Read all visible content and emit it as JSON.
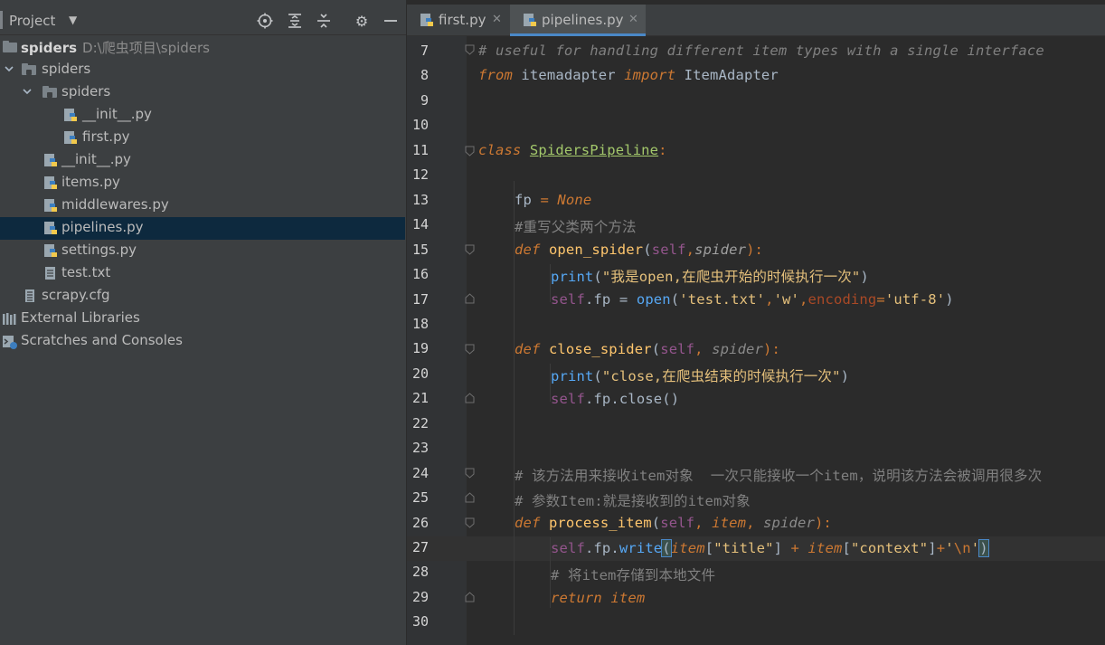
{
  "project_panel": {
    "title": "Project",
    "toolbar_icons": [
      "locate-icon",
      "expand-all-icon",
      "collapse-all-icon",
      "gear-icon",
      "minimize-icon"
    ],
    "tree": [
      {
        "label": "spiders",
        "path": "D:\\爬虫项目\\spiders",
        "type": "root-folder",
        "depth": 0,
        "expanded": true,
        "bold": true
      },
      {
        "label": "spiders",
        "type": "package",
        "depth": 1,
        "expanded": true
      },
      {
        "label": "spiders",
        "type": "package",
        "depth": 2,
        "expanded": true
      },
      {
        "label": "__init__.py",
        "type": "python",
        "depth": 3
      },
      {
        "label": "first.py",
        "type": "python",
        "depth": 3
      },
      {
        "label": "__init__.py",
        "type": "python",
        "depth": 2
      },
      {
        "label": "items.py",
        "type": "python",
        "depth": 2
      },
      {
        "label": "middlewares.py",
        "type": "python",
        "depth": 2
      },
      {
        "label": "pipelines.py",
        "type": "python",
        "depth": 2,
        "selected": true
      },
      {
        "label": "settings.py",
        "type": "python",
        "depth": 2
      },
      {
        "label": "test.txt",
        "type": "text",
        "depth": 2
      },
      {
        "label": "scrapy.cfg",
        "type": "config",
        "depth": 1
      },
      {
        "label": "External Libraries",
        "type": "libraries",
        "depth": 0
      },
      {
        "label": "Scratches and Consoles",
        "type": "scratches",
        "depth": 0
      }
    ]
  },
  "editor": {
    "tabs": [
      {
        "label": "first.py",
        "active": false
      },
      {
        "label": "pipelines.py",
        "active": true
      }
    ],
    "current_line": 27,
    "lines": [
      {
        "n": "7"
      },
      {
        "n": "8"
      },
      {
        "n": "9"
      },
      {
        "n": "10"
      },
      {
        "n": "11"
      },
      {
        "n": "12"
      },
      {
        "n": "13"
      },
      {
        "n": "14"
      },
      {
        "n": "15"
      },
      {
        "n": "16"
      },
      {
        "n": "17"
      },
      {
        "n": "18"
      },
      {
        "n": "19"
      },
      {
        "n": "20"
      },
      {
        "n": "21"
      },
      {
        "n": "22"
      },
      {
        "n": "23"
      },
      {
        "n": "24"
      },
      {
        "n": "25"
      },
      {
        "n": "26"
      },
      {
        "n": "27"
      },
      {
        "n": "28"
      },
      {
        "n": "29"
      },
      {
        "n": "30"
      }
    ],
    "code": {
      "l7_comment": "# useful for handling different item types with a single interface",
      "l8_from": "from",
      "l8_mod": " itemadapter ",
      "l8_import": "import",
      "l8_name": " ItemAdapter",
      "l11_class": "class",
      "l11_name": "SpidersPipeline",
      "l11_colon": ":",
      "l13_fp": "fp",
      "l13_eq": " = ",
      "l13_none": "None",
      "l14_comment": "#重写父类两个方法",
      "l15_def": "def",
      "l15_fn": "open_spider",
      "l15_open": "(",
      "l15_self": "self",
      "l15_comma": ",",
      "l15_arg": "spider",
      "l15_close": "):",
      "l16_print": "print",
      "l16_open": "(",
      "l16_str": "\"我是open,在爬虫开始的时候执行一次\"",
      "l16_close": ")",
      "l17_self": "self",
      "l17_fp": ".fp = ",
      "l17_open": "open",
      "l17_p1": "(",
      "l17_s1": "'test.txt'",
      "l17_c1": ",",
      "l17_s2": "'w'",
      "l17_c2": ",",
      "l17_kw": "encoding",
      "l17_eq": "=",
      "l17_s3": "'utf-8'",
      "l17_p2": ")",
      "l19_def": "def",
      "l19_fn": "close_spider",
      "l19_open": "(",
      "l19_self": "self",
      "l19_comma": ", ",
      "l19_arg": "spider",
      "l19_close": "):",
      "l20_print": "print",
      "l20_open": "(",
      "l20_str": "\"close,在爬虫结束的时候执行一次\"",
      "l20_close": ")",
      "l21_self": "self",
      "l21_rest": ".fp.close()",
      "l24_comment": "# 该方法用来接收item对象  一次只能接收一个item，说明该方法会被调用很多次",
      "l25_comment": "# 参数Item:就是接收到的item对象",
      "l26_def": "def",
      "l26_fn": "process_item",
      "l26_open": "(",
      "l26_self": "self",
      "l26_c1": ", ",
      "l26_item": "item",
      "l26_c2": ", ",
      "l26_spider": "spider",
      "l26_close": "):",
      "l27_self": "self",
      "l27_fp": ".fp.",
      "l27_write": "write",
      "l27_open": "(",
      "l27_item1": "item",
      "l27_b1": "[",
      "l27_s1": "\"title\"",
      "l27_b2": "] ",
      "l27_plus1": "+",
      "l27_sp": " ",
      "l27_item2": "item",
      "l27_b3": "[",
      "l27_s2": "\"context\"",
      "l27_b4": "]",
      "l27_plus2": "+",
      "l27_q1": "'",
      "l27_esc": "\\n",
      "l27_q2": "'",
      "l27_close": ")",
      "l28_comment": "# 将item存储到本地文件",
      "l29_return": "return",
      "l29_item": " item"
    }
  },
  "colors": {
    "panel_bg": "#3c3f41",
    "editor_bg": "#2b2b2b",
    "selection": "#0d293e",
    "keyword": "#cc7832",
    "string": "#6a8759",
    "function": "#ffc66d",
    "comment": "#808080",
    "self": "#94558d"
  }
}
